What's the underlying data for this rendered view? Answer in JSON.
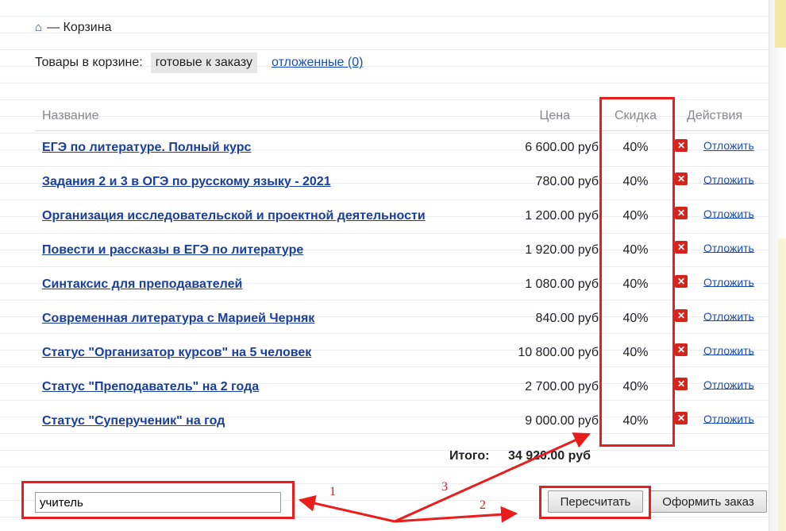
{
  "breadcrumb": {
    "home_icon": "home-icon",
    "separator": "—",
    "current": "Корзина"
  },
  "filter": {
    "label": "Товары в корзине:",
    "active": "готовые к заказу",
    "deferred_link": "отложенные (0)"
  },
  "table": {
    "headers": {
      "name": "Название",
      "price": "Цена",
      "discount": "Скидка",
      "actions": "Действия"
    },
    "rows": [
      {
        "name": "ЕГЭ по литературе. Полный курс",
        "price": "6 600.00 руб",
        "discount": "40%",
        "action": "Отложить"
      },
      {
        "name": "Задания 2 и 3 в ОГЭ по русскому языку - 2021",
        "price": "780.00 руб",
        "discount": "40%",
        "action": "Отложить"
      },
      {
        "name": "Организация исследовательской и проектной деятельности",
        "price": "1 200.00 руб",
        "discount": "40%",
        "action": "Отложить"
      },
      {
        "name": "Повести и рассказы в ЕГЭ по литературе",
        "price": "1 920.00 руб",
        "discount": "40%",
        "action": "Отложить"
      },
      {
        "name": "Синтаксис для преподавателей",
        "price": "1 080.00 руб",
        "discount": "40%",
        "action": "Отложить"
      },
      {
        "name": "Современная литература с Марией Черняк",
        "price": "840.00 руб",
        "discount": "40%",
        "action": "Отложить"
      },
      {
        "name": "Статус \"Организатор курсов\" на 5 человек",
        "price": "10 800.00 руб",
        "discount": "40%",
        "action": "Отложить"
      },
      {
        "name": "Статус \"Преподаватель\" на 2 года",
        "price": "2 700.00 руб",
        "discount": "40%",
        "action": "Отложить"
      },
      {
        "name": "Статус \"Суперученик\" на год",
        "price": "9 000.00 руб",
        "discount": "40%",
        "action": "Отложить"
      }
    ]
  },
  "total": {
    "label": "Итого:",
    "value": "34 920.00 руб"
  },
  "coupon": {
    "value": "учитель"
  },
  "buttons": {
    "recalc": "Пересчитать",
    "order": "Оформить заказ"
  },
  "annotations": {
    "n1": "1",
    "n2": "2",
    "n3": "3",
    "color": "#ea1d1d"
  },
  "colors": {
    "link": "#1a3f9a",
    "delete": "#d4251c",
    "highlight": "#ea1d1d"
  }
}
